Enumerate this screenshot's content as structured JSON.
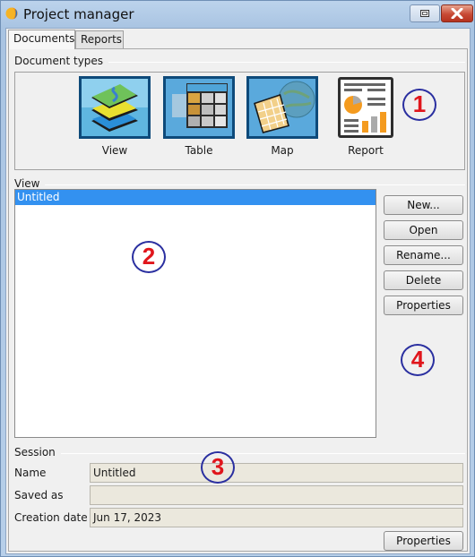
{
  "window": {
    "title": "Project manager",
    "app_icon": "project-manager-app-icon",
    "controls": [
      {
        "name": "restore",
        "icon": "restore-icon"
      },
      {
        "name": "close",
        "icon": "close-icon"
      }
    ]
  },
  "tabs": [
    {
      "label": "Documents",
      "active": true
    },
    {
      "label": "Reports",
      "active": false
    }
  ],
  "document_types": {
    "group_label": "Document types",
    "items": [
      {
        "label": "View",
        "icon": "view-layers-icon"
      },
      {
        "label": "Table",
        "icon": "table-grid-icon"
      },
      {
        "label": "Map",
        "icon": "map-globe-icon"
      },
      {
        "label": "Report",
        "icon": "report-chart-icon"
      }
    ]
  },
  "document_list": {
    "group_label": "View",
    "items": [
      {
        "label": "Untitled",
        "selected": true
      }
    ]
  },
  "document_actions": [
    {
      "label": "New..."
    },
    {
      "label": "Open"
    },
    {
      "label": "Rename..."
    },
    {
      "label": "Delete"
    },
    {
      "label": "Properties"
    }
  ],
  "session": {
    "group_label": "Session",
    "fields": [
      {
        "label": "Name",
        "value": "Untitled"
      },
      {
        "label": "Saved as",
        "value": ""
      },
      {
        "label": "Creation date",
        "value": "Jun 17, 2023"
      }
    ],
    "properties_label": "Properties"
  },
  "annotations": [
    "1",
    "2",
    "3",
    "4"
  ],
  "colors": {
    "selection": "#3391f0",
    "annotation_text": "#e0161c",
    "annotation_ring": "#2a2fa0",
    "readonly_field": "#ebe8dd"
  }
}
